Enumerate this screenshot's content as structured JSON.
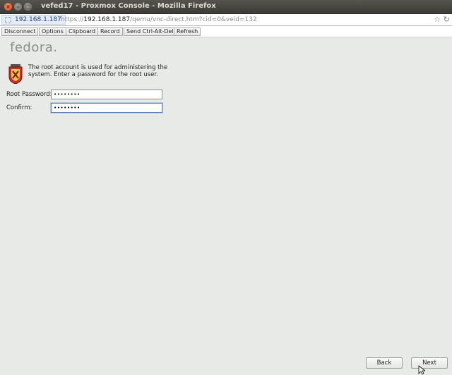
{
  "window": {
    "title": "vefed17 - Proxmox Console - Mozilla Firefox",
    "close_glyph": "×",
    "min_glyph": "–",
    "max_glyph": "□"
  },
  "urlbar": {
    "identity": "192.168.1.187",
    "url_prefix": "https://",
    "url_host": "192.168.1.187",
    "url_path": "/qemu/vnc-direct.htm?cid=0&veid=132",
    "star_icon": "star-icon",
    "reload_icon": "reload-icon"
  },
  "vnc_toolbar": {
    "buttons": [
      "Disconnect",
      "Options",
      "Clipboard",
      "Record",
      "Send Ctrl-Alt-Del",
      "Refresh"
    ]
  },
  "installer": {
    "logo": "fedora",
    "info_text": "The root account is used for administering the system.  Enter a password for the root user.",
    "root_password_label": "Root Password:",
    "root_password_value": "••••••••",
    "confirm_label": "Confirm:",
    "confirm_value": "••••••••",
    "back_label": "Back",
    "next_label": "Next"
  },
  "colors": {
    "titlebar": "#3c3b37",
    "content_bg": "#e7eae6",
    "close_button": "#df4a16"
  }
}
